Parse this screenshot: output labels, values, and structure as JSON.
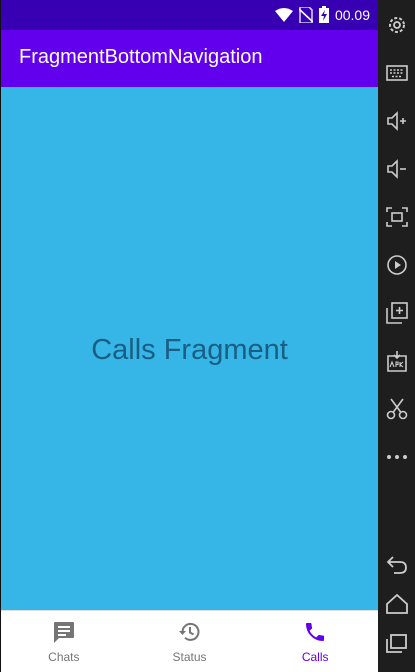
{
  "status_bar": {
    "time": "00.09",
    "icons": [
      "wifi-icon",
      "no-sim-icon",
      "battery-charging-icon"
    ]
  },
  "app_bar": {
    "title": "FragmentBottomNavigation"
  },
  "content": {
    "text": "Calls Fragment",
    "background": "#35B6E7"
  },
  "bottom_nav": {
    "items": [
      {
        "label": "Chats",
        "icon": "chat-icon",
        "active": false
      },
      {
        "label": "Status",
        "icon": "history-icon",
        "active": false
      },
      {
        "label": "Calls",
        "icon": "phone-icon",
        "active": true
      }
    ],
    "active_color": "#6200EE"
  },
  "emulator_toolbar": {
    "buttons": [
      "settings-icon",
      "keyboard-icon",
      "volume-up-icon",
      "volume-down-icon",
      "screenshot-icon",
      "screen-record-icon",
      "add-window-icon",
      "install-apk-icon",
      "cut-icon",
      "more-icon",
      "back-icon",
      "home-icon",
      "overview-icon"
    ]
  },
  "colors": {
    "status_bar": "#3700B3",
    "app_bar": "#6200EE"
  }
}
